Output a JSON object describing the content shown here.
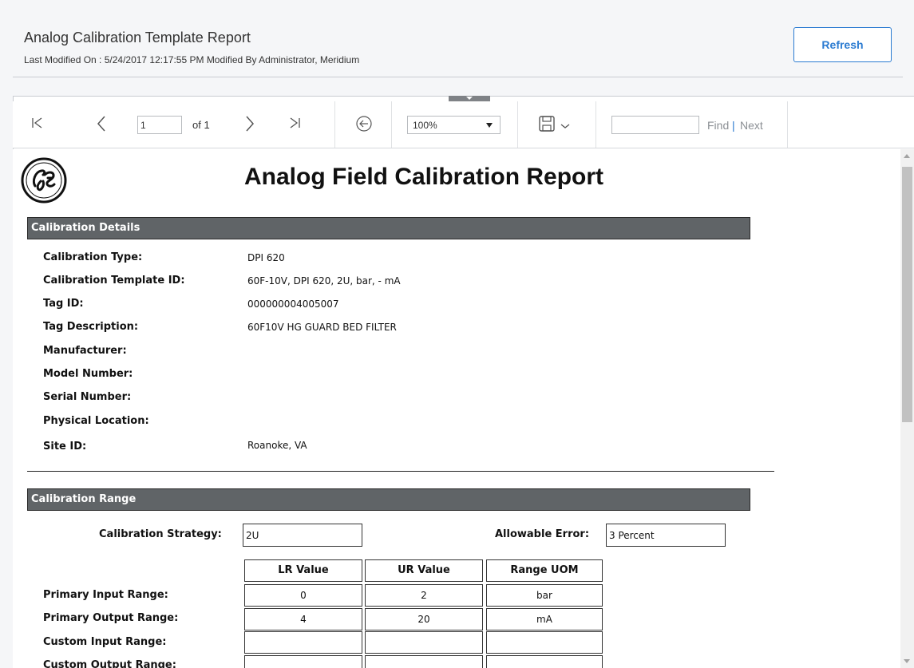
{
  "header": {
    "title": "Analog Calibration Template Report",
    "subtitle": "Last Modified On : 5/24/2017 12:17:55 PM Modified By Administrator, Meridium",
    "refresh_label": "Refresh"
  },
  "toolbar": {
    "page_value": "1",
    "of_label": "of 1",
    "zoom": "100%",
    "find_label": "Find",
    "separator": "|",
    "next_label": "Next"
  },
  "report": {
    "title": "Analog Field Calibration Report",
    "calibration_details": {
      "heading": "Calibration Details",
      "rows": [
        {
          "label": "Calibration Type:",
          "value": "DPI 620"
        },
        {
          "label": "Calibration Template ID:",
          "value": "60F-10V, DPI 620, 2U, bar,  - mA"
        },
        {
          "label": "Tag ID:",
          "value": "000000004005007"
        },
        {
          "label": "Tag Description:",
          "value": "60F10V HG GUARD BED FILTER"
        },
        {
          "label": "Manufacturer:",
          "value": ""
        },
        {
          "label": "Model Number:",
          "value": ""
        },
        {
          "label": "Serial Number:",
          "value": ""
        },
        {
          "label": "Physical Location:",
          "value": ""
        },
        {
          "label": "Site ID:",
          "value": "Roanoke, VA"
        }
      ]
    },
    "calibration_range": {
      "heading": "Calibration Range",
      "strategy_label": "Calibration Strategy:",
      "strategy_value": "2U",
      "allowable_error_label": "Allowable Error:",
      "allowable_error_value": "3 Percent",
      "columns": [
        "LR Value",
        "UR Value",
        "Range UOM"
      ],
      "rows": [
        {
          "label": "Primary Input Range:",
          "values": [
            "0",
            "2",
            "bar"
          ]
        },
        {
          "label": "Primary Output Range:",
          "values": [
            "4",
            "20",
            "mA"
          ]
        },
        {
          "label": "Custom Input Range:",
          "values": [
            "",
            "",
            ""
          ]
        },
        {
          "label": "Custom Output Range:",
          "values": [
            "",
            "",
            ""
          ]
        }
      ]
    }
  }
}
